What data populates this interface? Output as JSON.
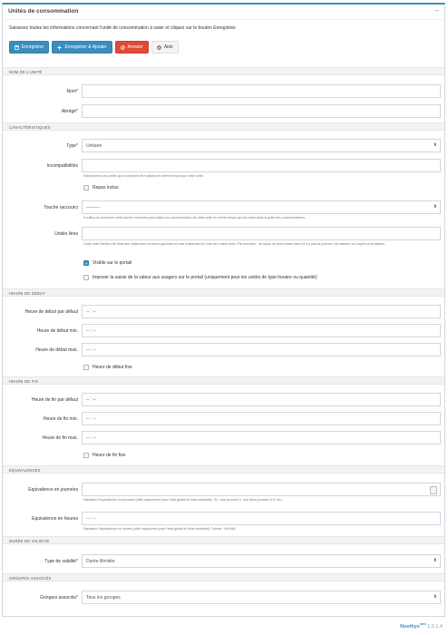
{
  "panel": {
    "title": "Unités de consommation",
    "collapse": "–"
  },
  "intro": "Saisissez toutes les informations concernant l'unité de consommation à saisir et cliquez sur le bouton Enregistrer.",
  "toolbar": {
    "save": "Enregistrer",
    "save_add": "Enregistrer & Ajouter",
    "cancel": "Annuler",
    "help": "Aide"
  },
  "colors": {
    "primary": "#3c8dbc",
    "danger": "#dd4b39",
    "section_bg": "#f3f3f3"
  },
  "sections": {
    "name": "NOM DE L'UNITÉ",
    "characteristics": "CARACTÉRISTIQUES",
    "start": "HEURE DE DÉBUT",
    "end": "HEURE DE FIN",
    "equivalences": "EQUIVALENCES",
    "validity": "DURÉE DE VALIDITÉ",
    "groups": "GROUPES ASSOCIÉS"
  },
  "fields": {
    "nom": {
      "label": "Nom*",
      "value": ""
    },
    "abrege": {
      "label": "Abrégé*",
      "value": ""
    },
    "type": {
      "label": "Type*",
      "value": "Unitaire"
    },
    "incompat": {
      "label": "Incompatibilités",
      "value": "",
      "help": "Sélectionnez les unités qui ne peuvent être saisies en même temps que cette unité."
    },
    "repas": {
      "label": "Repas inclus",
      "checked": false
    },
    "touche": {
      "label": "Touche raccourci",
      "value": "---------",
      "help": "Il suffira de conserver cette touche enfoncée pour saisir une consommation de cette unité en même temps qu'une autre dans la grille des consommations."
    },
    "liees": {
      "label": "Unités liées",
      "value": "",
      "help": "Cette unité héritera de l'état des unités liées et sera supprimée en cas d'absence de l'une des unités liées. Par exemple : un repas ne peut exister sauf s'il n'y pas de journée, de matinée ou d'après-midi saisies."
    },
    "visible": {
      "label": "Visible sur le portail",
      "checked": true
    },
    "imposer": {
      "label": "Imposer la saisie de la valeur aux usagers sur le portail (uniquement pour les unités de type horaire ou quantité)",
      "checked": false
    },
    "debut_defaut": {
      "label": "Heure de début par défaut",
      "value": "-- : --"
    },
    "debut_min": {
      "label": "Heure de début min.",
      "value": "-- : --"
    },
    "debut_max": {
      "label": "Heure de début max.",
      "value": "-- : --"
    },
    "debut_fixe": {
      "label": "Heure de début fixe",
      "checked": false
    },
    "fin_defaut": {
      "label": "Heure de fin par défaut",
      "value": "-- : --"
    },
    "fin_min": {
      "label": "Heure de fin min.",
      "value": "-- : --"
    },
    "fin_max": {
      "label": "Heure de fin max.",
      "value": "-- : --"
    },
    "fin_fixe": {
      "label": "Heure de fin fixe",
      "checked": false
    },
    "eq_jours": {
      "label": "Equivalence en journées",
      "value": "",
      "help": "Saisissez l'équivalence en journées (utile uniquement pour l'état global et l'état nominatif). Ex : une journée=1, une demi-journée=0.5, etc..."
    },
    "eq_heures": {
      "label": "Equivalence en heures",
      "value": "-- : --",
      "help": "Saisissez l'équivalence en heures (utile uniquement pour l'état global et l'état nominatif). Format : HH:MM."
    },
    "validite": {
      "label": "Type de validité*",
      "value": "Durée illimitée"
    },
    "groupes": {
      "label": "Groupes associés*",
      "value": "Tous les groupes"
    }
  },
  "footer": {
    "brand": "Noethys",
    "sup": "web",
    "version": "1.2.1.4"
  }
}
